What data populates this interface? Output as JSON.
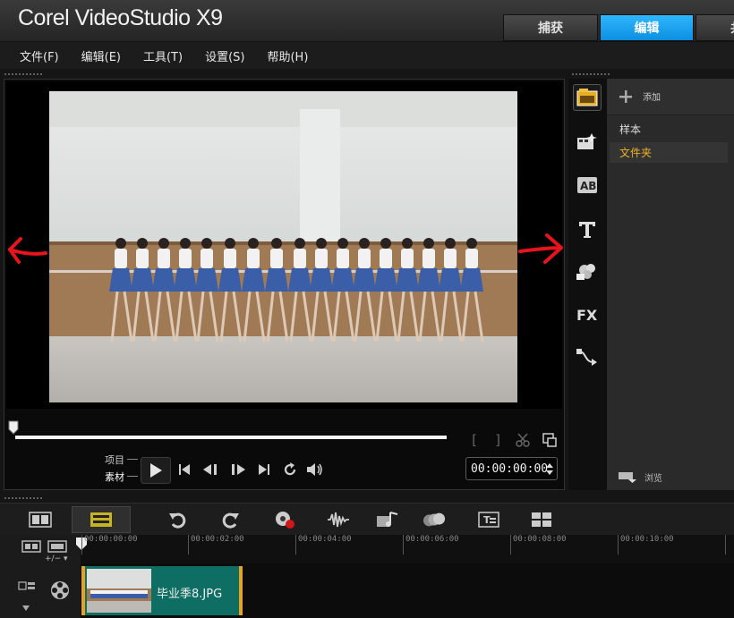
{
  "app": {
    "title": "Corel VideoStudio X9",
    "brand_color": "#1aa4f5"
  },
  "tabs": [
    {
      "label": "捕获",
      "active": false
    },
    {
      "label": "编辑",
      "active": true
    },
    {
      "label": "共",
      "active": false
    }
  ],
  "menu": [
    "文件(F)",
    "编辑(E)",
    "工具(T)",
    "设置(S)",
    "帮助(H)"
  ],
  "player": {
    "mode_project": "项目",
    "mode_clip": "素材",
    "timecode": "00:00:00:00",
    "scrub_position": 0,
    "controls": [
      "play-icon",
      "go-to-start-icon",
      "previous-frame-icon",
      "next-frame-icon",
      "go-to-end-icon",
      "repeat-icon",
      "volume-icon"
    ],
    "mark_in": "[",
    "mark_out": "]"
  },
  "annotation_color": "#e8141c",
  "library": {
    "add_label": "添加",
    "items": [
      {
        "label": "样本",
        "selected": false
      },
      {
        "label": "文件夹",
        "selected": true
      }
    ],
    "browse_label": "浏览",
    "side_icons": [
      "media-icon",
      "instant-project-icon",
      "transition-icon",
      "title-icon",
      "graphic-icon",
      "filter-icon",
      "path-icon"
    ]
  },
  "timeline": {
    "ruler": [
      "00:00:00:00",
      "00:00:02:00",
      "00:00:04:00",
      "00:00:06:00",
      "00:00:08:00",
      "00:00:10:00"
    ],
    "tools": [
      "undo-icon",
      "redo-icon",
      "record-capture-icon",
      "sound-mixer-icon",
      "auto-music-icon",
      "motion-tracking-icon",
      "subtitle-editor-icon",
      "multi-camera-icon"
    ],
    "clip_name": "毕业季8.JPG"
  }
}
